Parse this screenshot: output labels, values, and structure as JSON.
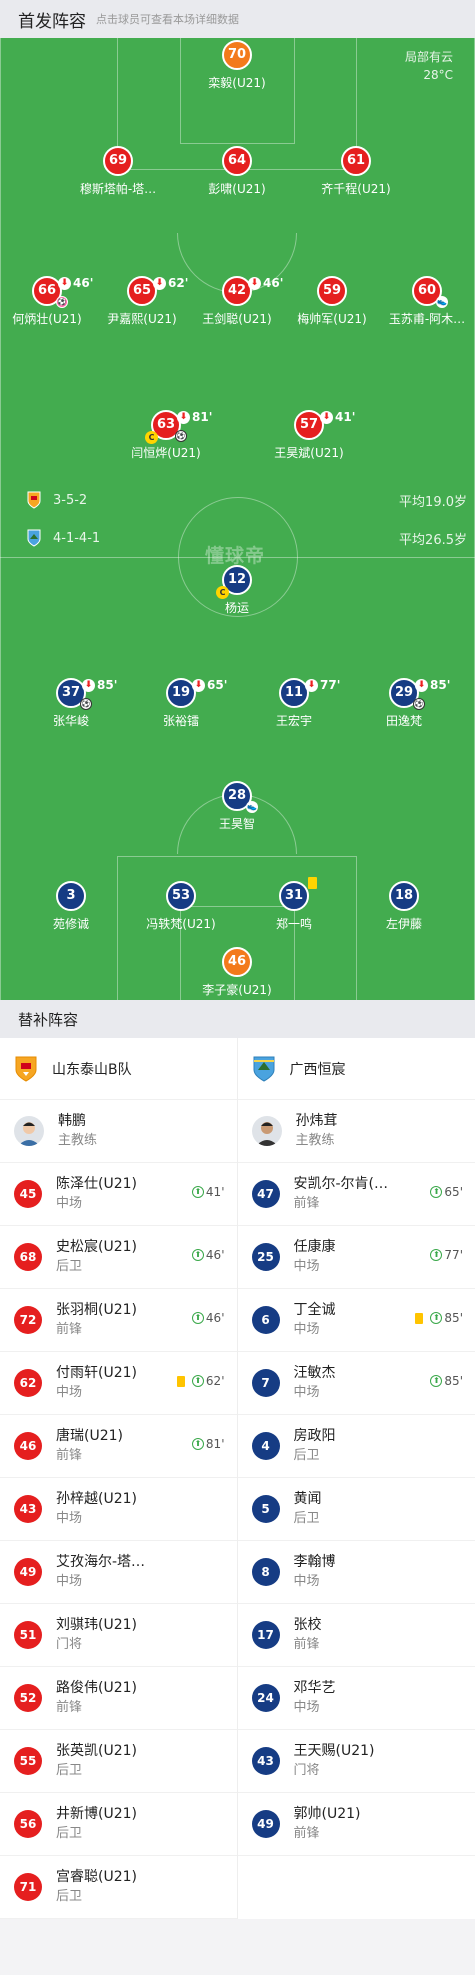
{
  "header": {
    "title": "首发阵容",
    "hint": "点击球员可查看本场详细数据"
  },
  "weather": {
    "condition": "局部有云",
    "temp": "28°C"
  },
  "home_team": {
    "formation": "3-5-2",
    "avg_age": "平均19.0岁"
  },
  "away_team": {
    "formation": "4-1-4-1",
    "avg_age": "平均26.5岁"
  },
  "watermark": "懂球帝",
  "home_lineup": [
    {
      "num": "70",
      "name": "栾毅(U21)",
      "color": "orange"
    },
    {
      "num": "69",
      "name": "穆斯塔帕-塔…",
      "color": "red"
    },
    {
      "num": "64",
      "name": "彭啸(U21)",
      "color": "red"
    },
    {
      "num": "61",
      "name": "齐千程(U21)",
      "color": "red"
    },
    {
      "num": "66",
      "name": "何炳壮(U21)",
      "color": "red",
      "sub": "46'"
    },
    {
      "num": "65",
      "name": "尹嘉熙(U21)",
      "color": "red",
      "sub": "62'"
    },
    {
      "num": "42",
      "name": "王剑聪(U21)",
      "color": "red",
      "sub": "46'"
    },
    {
      "num": "59",
      "name": "梅帅军(U21)",
      "color": "red"
    },
    {
      "num": "60",
      "name": "玉苏甫-阿木…",
      "color": "red"
    },
    {
      "num": "63",
      "name": "闫恒烨(U21)",
      "color": "red",
      "sub": "81'"
    },
    {
      "num": "57",
      "name": "王昊斌(U21)",
      "color": "red",
      "sub": "41'"
    }
  ],
  "away_lineup": [
    {
      "num": "12",
      "name": "杨运",
      "color": "blue"
    },
    {
      "num": "37",
      "name": "张华峻",
      "color": "blue",
      "sub": "85'"
    },
    {
      "num": "19",
      "name": "张裕镭",
      "color": "blue",
      "sub": "65'"
    },
    {
      "num": "11",
      "name": "王宏宇",
      "color": "blue",
      "sub": "77'"
    },
    {
      "num": "29",
      "name": "田逸梵",
      "color": "blue",
      "sub": "85'"
    },
    {
      "num": "28",
      "name": "王昊智",
      "color": "blue"
    },
    {
      "num": "3",
      "name": "苑修诚",
      "color": "blue"
    },
    {
      "num": "53",
      "name": "冯轶梵(U21)",
      "color": "blue"
    },
    {
      "num": "31",
      "name": "郑一鸣",
      "color": "blue"
    },
    {
      "num": "18",
      "name": "左伊藤",
      "color": "blue"
    },
    {
      "num": "46",
      "name": "李子豪(U21)",
      "color": "orange"
    }
  ],
  "subs_title": "替补阵容",
  "left_team": "山东泰山B队",
  "right_team": "广西恒宸",
  "left_coach": {
    "name": "韩鹏",
    "role": "主教练"
  },
  "right_coach": {
    "name": "孙炜茸",
    "role": "主教练"
  },
  "left_subs": [
    {
      "num": "45",
      "name": "陈泽仕(U21)",
      "pos": "中场",
      "in": "41'"
    },
    {
      "num": "68",
      "name": "史松宸(U21)",
      "pos": "后卫",
      "in": "46'"
    },
    {
      "num": "72",
      "name": "张羽桐(U21)",
      "pos": "前锋",
      "in": "46'"
    },
    {
      "num": "62",
      "name": "付雨轩(U21)",
      "pos": "中场",
      "in": "62'",
      "yellow": true
    },
    {
      "num": "46",
      "name": "唐瑞(U21)",
      "pos": "前锋",
      "in": "81'"
    },
    {
      "num": "43",
      "name": "孙梓越(U21)",
      "pos": "中场"
    },
    {
      "num": "49",
      "name": "艾孜海尔-塔…",
      "pos": "中场"
    },
    {
      "num": "51",
      "name": "刘骐玮(U21)",
      "pos": "门将"
    },
    {
      "num": "52",
      "name": "路俊伟(U21)",
      "pos": "前锋"
    },
    {
      "num": "55",
      "name": "张英凯(U21)",
      "pos": "后卫"
    },
    {
      "num": "56",
      "name": "井新博(U21)",
      "pos": "后卫"
    },
    {
      "num": "71",
      "name": "宫睿聪(U21)",
      "pos": "后卫"
    }
  ],
  "right_subs": [
    {
      "num": "47",
      "name": "安凯尔-尔肯(…",
      "pos": "前锋",
      "in": "65'"
    },
    {
      "num": "25",
      "name": "任康康",
      "pos": "中场",
      "in": "77'"
    },
    {
      "num": "6",
      "name": "丁全诚",
      "pos": "中场",
      "in": "85'",
      "yellow": true
    },
    {
      "num": "7",
      "name": "汪敏杰",
      "pos": "中场",
      "in": "85'"
    },
    {
      "num": "4",
      "name": "房政阳",
      "pos": "后卫"
    },
    {
      "num": "5",
      "name": "黄闻",
      "pos": "后卫"
    },
    {
      "num": "8",
      "name": "李翰博",
      "pos": "中场"
    },
    {
      "num": "17",
      "name": "张校",
      "pos": "前锋"
    },
    {
      "num": "24",
      "name": "邓华艺",
      "pos": "中场"
    },
    {
      "num": "43",
      "name": "王天赐(U21)",
      "pos": "门将"
    },
    {
      "num": "49",
      "name": "郭帅(U21)",
      "pos": "前锋"
    }
  ]
}
